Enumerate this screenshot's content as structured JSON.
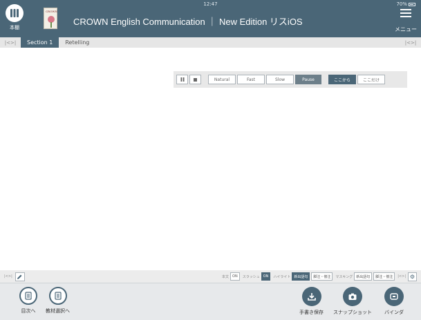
{
  "status": {
    "time": "12:47",
    "battery": "70%"
  },
  "header": {
    "bookshelf_label": "本棚",
    "cover_text": "CROWN",
    "title": "CROWN English Communication ｜ New Edition リスiOS",
    "menu_label": "メニュー"
  },
  "tabs": {
    "left_nav": "|<>|",
    "right_nav": "|<>|",
    "items": [
      {
        "label": "Section 1",
        "active": true
      },
      {
        "label": "Retelling",
        "active": false
      }
    ]
  },
  "audio_controls": {
    "speeds": [
      "Natural",
      "Fast",
      "Slow"
    ],
    "pause": "Pause",
    "from_here": "ここから",
    "only_here": "ここだけ"
  },
  "subbar": {
    "left_nav": "|<>|",
    "right_nav": "|<>|",
    "honbun_label": "本文",
    "honbun_value": "ON",
    "slash_label": "スラッシュ",
    "slash_value": "ON",
    "highlight_label": "ハイライト",
    "highlight_new": "新出語句",
    "highlight_notes": "脚注・傍注",
    "masking_label": "マスキング",
    "masking_new": "新出語句",
    "masking_notes": "脚注・傍注"
  },
  "footer": {
    "toc": "目次へ",
    "material": "教材選択へ",
    "save": "手書き保存",
    "snapshot": "スナップショット",
    "binder": "バインダ"
  },
  "colors": {
    "accent": "#4a6677",
    "background": "#ffffff"
  }
}
